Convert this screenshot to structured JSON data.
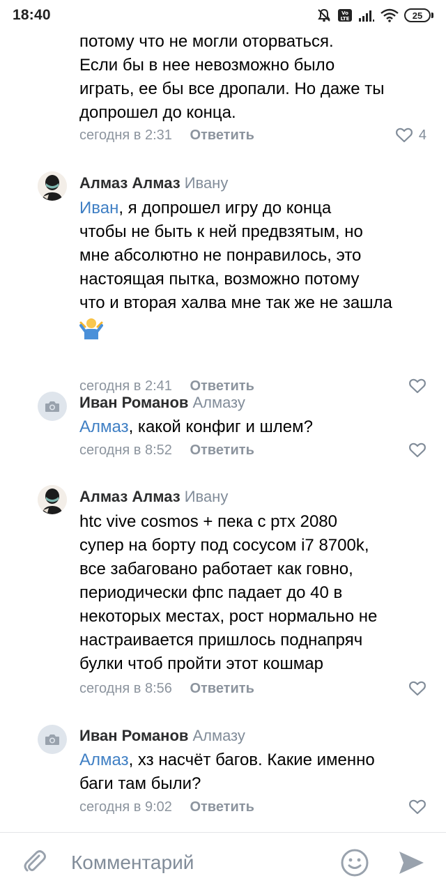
{
  "status_bar": {
    "time": "18:40",
    "battery": "25",
    "icons": [
      "mute-icon",
      "volte-icon",
      "signal-icon",
      "wifi-icon",
      "battery-icon"
    ]
  },
  "comments": [
    {
      "id": "c0",
      "text_lines": [
        "потому что не могли оторваться.",
        "Если бы в нее невозможно было",
        "играть, ее бы все дропали. Но даже ты",
        "допрошел до конца."
      ],
      "time": "сегодня в 2:31",
      "reply_label": "Ответить",
      "likes": "4"
    },
    {
      "id": "c1",
      "author": "Алмаз Алмаз",
      "reply_to": "Ивану",
      "mention": "Иван",
      "text_first_rest": ", я допрошел игру до конца",
      "text_lines": [
        "чтобы не быть к ней предвзятым, но",
        "мне абсолютно не понравилось, это",
        "настоящая пытка, возможно потому",
        "что и вторая халва мне так же не зашла"
      ],
      "emoji": "shrug-emoji",
      "time": "сегодня в 2:41",
      "reply_label": "Ответить"
    },
    {
      "id": "c2",
      "author": "Иван Романов",
      "reply_to": "Алмазу",
      "mention": "Алмаз",
      "text_first_rest": ", какой конфиг и шлем?",
      "time": "сегодня в 8:52",
      "reply_label": "Ответить"
    },
    {
      "id": "c3",
      "author": "Алмаз Алмаз",
      "reply_to": "Ивану",
      "text_lines": [
        "htc vive cosmos + пека с ртх 2080",
        "супер на борту под сосусом i7 8700k,",
        "все забаговано работает как говно,",
        "периодически фпс падает до 40 в",
        "некоторых местах, рост нормально не",
        "настраивается пришлось поднапряч",
        "булки чтоб пройти этот кошмар"
      ],
      "time": "сегодня в 8:56",
      "reply_label": "Ответить"
    },
    {
      "id": "c4",
      "author": "Иван Романов",
      "reply_to": "Алмазу",
      "mention": "Алмаз",
      "text_first_rest": ", хз насчёт багов. Какие именно",
      "text_lines": [
        "баги там были?"
      ],
      "time": "сегодня в 9:02",
      "reply_label": "Ответить"
    }
  ],
  "input_bar": {
    "placeholder": "Комментарий"
  },
  "colors": {
    "mention": "#3f7fc4",
    "meta": "#8c949e",
    "author": "#2c2d2e"
  }
}
